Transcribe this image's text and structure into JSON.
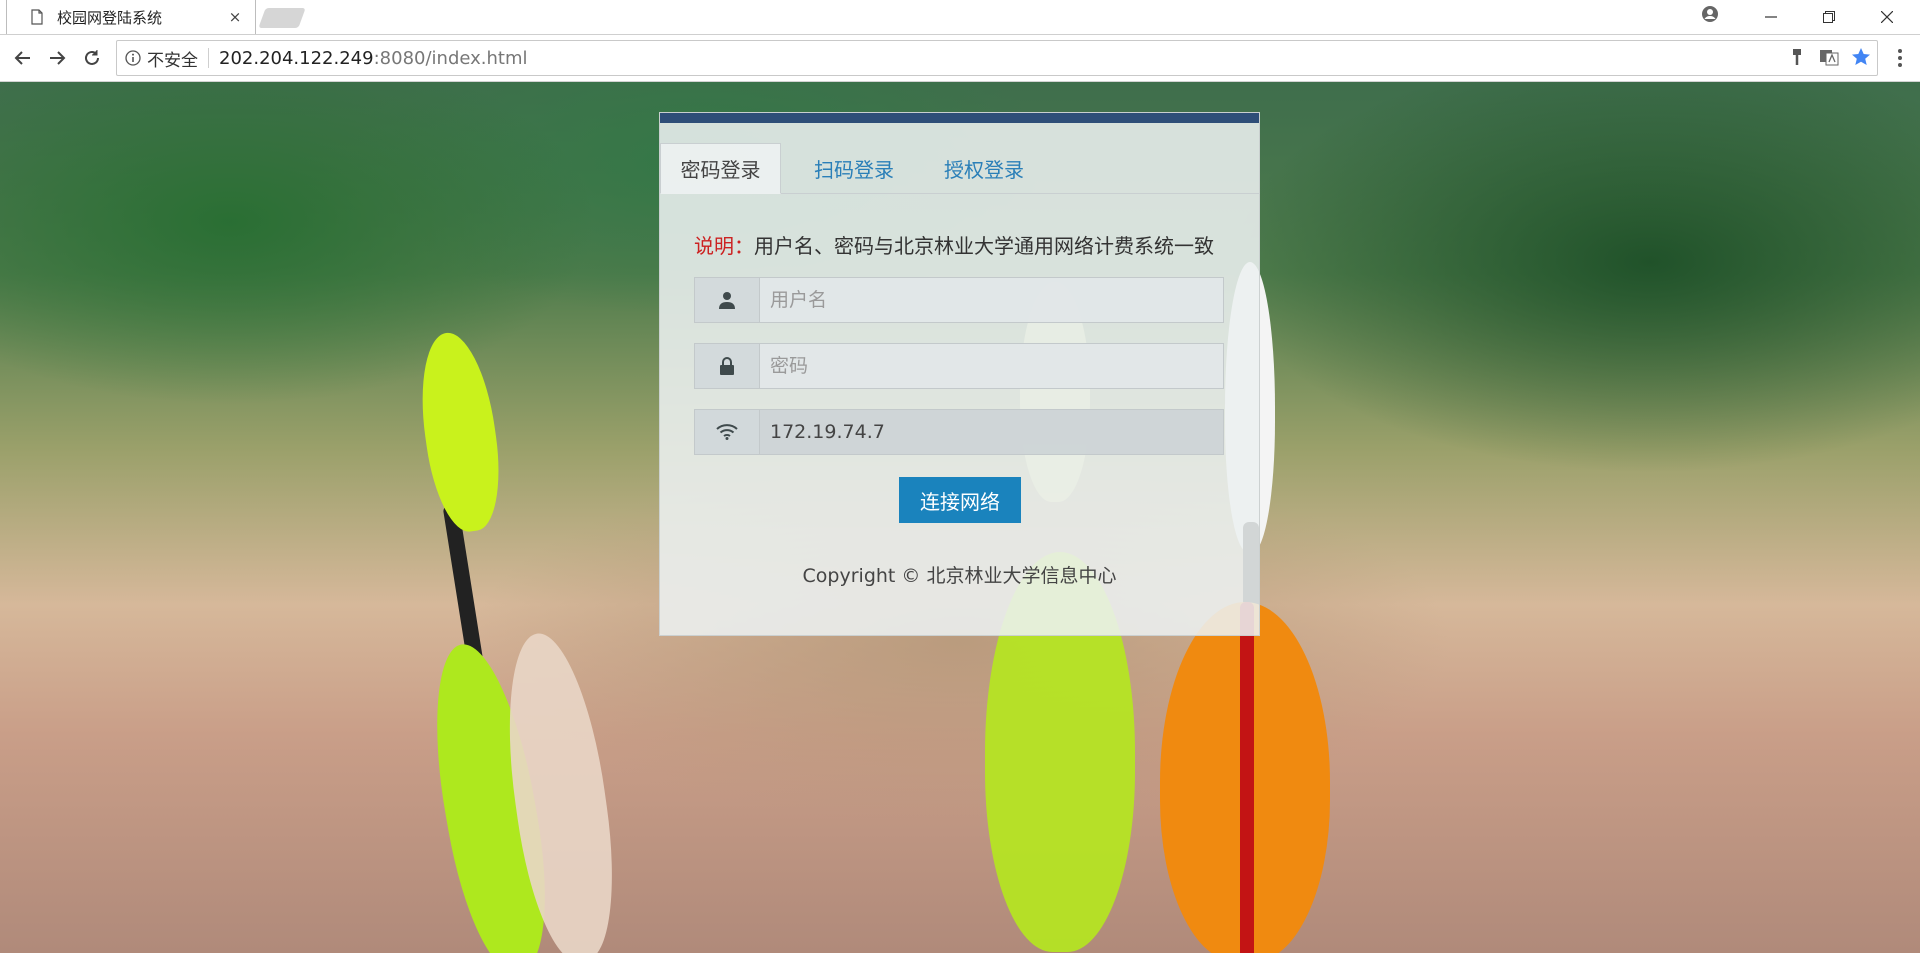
{
  "browser": {
    "tab_title": "校园网登陆系统",
    "tab_close": "×",
    "security_label": "不安全",
    "url_host": "202.204.122.249",
    "url_path": ":8080/index.html"
  },
  "panel": {
    "tabs": [
      {
        "label": "密码登录"
      },
      {
        "label": "扫码登录"
      },
      {
        "label": "授权登录"
      }
    ],
    "note_label": "说明：",
    "note_text": "用户名、密码与北京林业大学通用网络计费系统一致",
    "username_placeholder": "用户名",
    "password_placeholder": "密码",
    "ip_value": "172.19.74.7",
    "connect_label": "连接网络",
    "copyright": "Copyright © 北京林业大学信息中心"
  },
  "colors": {
    "accent": "#1a83bd",
    "panel_top_bar": "#2e4e78",
    "note_label": "#cc2222",
    "tab_link": "#2a7fb8"
  },
  "icons": [
    "page-icon",
    "close-icon",
    "account-icon",
    "minimize-icon",
    "restore-icon",
    "window-close-icon",
    "back-arrow-icon",
    "forward-arrow-icon",
    "reload-icon",
    "info-icon",
    "key-icon",
    "translate-icon",
    "star-icon",
    "menu-icon",
    "user-icon",
    "lock-icon",
    "wifi-icon"
  ]
}
